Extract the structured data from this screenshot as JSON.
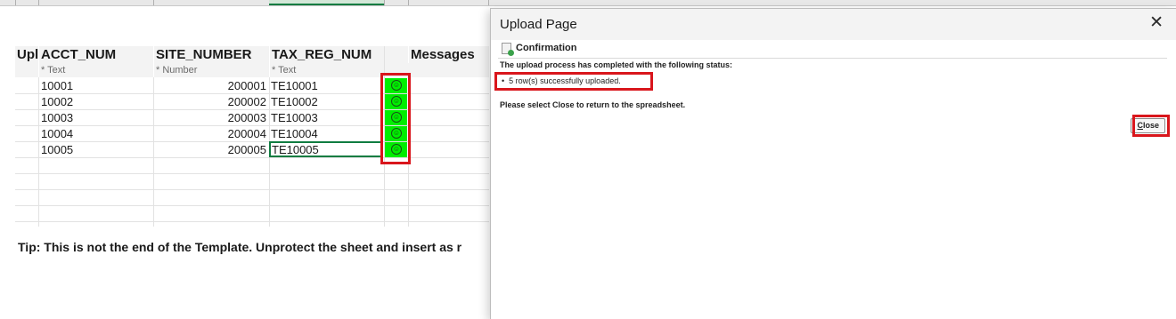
{
  "spreadsheet": {
    "headers": [
      "Upl",
      "ACCT_NUM",
      "SITE_NUMBER",
      "TAX_REG_NUM",
      "Messages"
    ],
    "subheaders": [
      "* Text",
      "* Number",
      "* Text"
    ],
    "rows": [
      {
        "acct": "10001",
        "site": "200001",
        "tax": "TE10001",
        "status": "☺"
      },
      {
        "acct": "10002",
        "site": "200002",
        "tax": "TE10002",
        "status": "☺"
      },
      {
        "acct": "10003",
        "site": "200003",
        "tax": "TE10003",
        "status": "☺"
      },
      {
        "acct": "10004",
        "site": "200004",
        "tax": "TE10004",
        "status": "☺"
      },
      {
        "acct": "10005",
        "site": "200005",
        "tax": "TE10005",
        "status": "☺"
      }
    ],
    "tip": "Tip: This is not the end of the Template.  Unprotect the sheet and insert as r",
    "status_color": "#00ee00"
  },
  "dialog": {
    "title": "Upload Page",
    "close_glyph": "✕",
    "confirmation_title": "Confirmation",
    "status_text": "The upload process has completed with the following status:",
    "status_items": [
      "5 row(s) successfully uploaded."
    ],
    "close_instruction": "Please select Close to return to the spreadsheet.",
    "close_button_first": "C",
    "close_button_rest": "lose",
    "icons": [
      "confirmation-icon",
      "close-icon"
    ],
    "highlight_color": "#d9161c"
  }
}
